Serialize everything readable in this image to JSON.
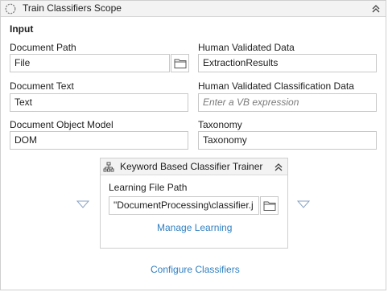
{
  "activity": {
    "title": "Train Classifiers Scope",
    "section_title": "Input",
    "document_path": {
      "label": "Document Path",
      "value": "File"
    },
    "human_validated_data": {
      "label": "Human Validated Data",
      "value": "ExtractionResults"
    },
    "document_text": {
      "label": "Document Text",
      "value": "Text"
    },
    "human_validated_classification_data": {
      "label": "Human Validated Classification Data",
      "placeholder": "Enter a VB expression"
    },
    "document_object_model": {
      "label": "Document Object Model",
      "value": "DOM"
    },
    "taxonomy": {
      "label": "Taxonomy",
      "value": "Taxonomy"
    },
    "configure_link": "Configure Classifiers"
  },
  "trainer": {
    "title": "Keyword Based Classifier Trainer",
    "learning_file_path": {
      "label": "Learning File Path",
      "value": "\"DocumentProcessing\\classifier.j"
    },
    "manage_link": "Manage Learning"
  },
  "icons": {
    "activity": "scope-circle-icon",
    "collapse": "double-chevron-up-icon",
    "folder": "folder-icon",
    "trainer": "hierarchy-icon",
    "drop_left": "triangle-down-icon",
    "drop_right": "triangle-down-icon"
  },
  "colors": {
    "link": "#2f7fc1",
    "header_bg": "#f3f3f3",
    "border": "#c8c8c8"
  }
}
